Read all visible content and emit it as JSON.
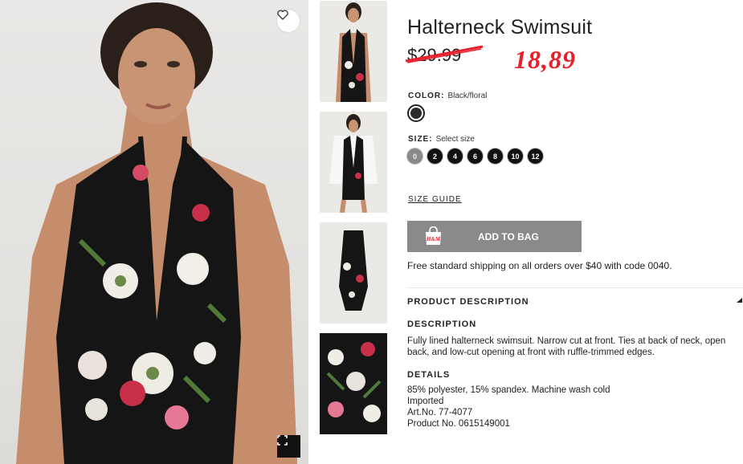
{
  "product": {
    "title": "Halterneck Swimsuit",
    "old_price": "$29.99",
    "new_price": "18,89"
  },
  "color": {
    "label": "COLOR:",
    "value": "Black/floral",
    "swatch_color": "#2a2a2a"
  },
  "size": {
    "label": "SIZE:",
    "value": "Select size",
    "options": [
      "0",
      "2",
      "4",
      "6",
      "8",
      "10",
      "12"
    ]
  },
  "size_guide": "SIZE GUIDE",
  "add_to_bag": "ADD TO BAG",
  "bag_icon_text": "H&M",
  "shipping": "Free standard shipping on all orders over $40 with code 0040.",
  "product_description": {
    "heading": "PRODUCT DESCRIPTION",
    "description_heading": "DESCRIPTION",
    "description_text": "Fully lined halterneck swimsuit. Narrow cut at front. Ties at back of neck, open back, and low-cut opening at front with ruffle-trimmed edges.",
    "details_heading": "DETAILS",
    "details": [
      "85% polyester, 15% spandex. Machine wash cold",
      "Imported",
      "Art.No. 77-4077",
      "Product No. 0615149001"
    ]
  },
  "icons": {
    "wishlist": "heart-icon",
    "expand": "expand-icon",
    "bag": "shopping-bag-icon",
    "chevron": "chevron-up-icon"
  },
  "colors": {
    "price_red": "#e8202b",
    "button_gray": "#8a8a8a"
  }
}
